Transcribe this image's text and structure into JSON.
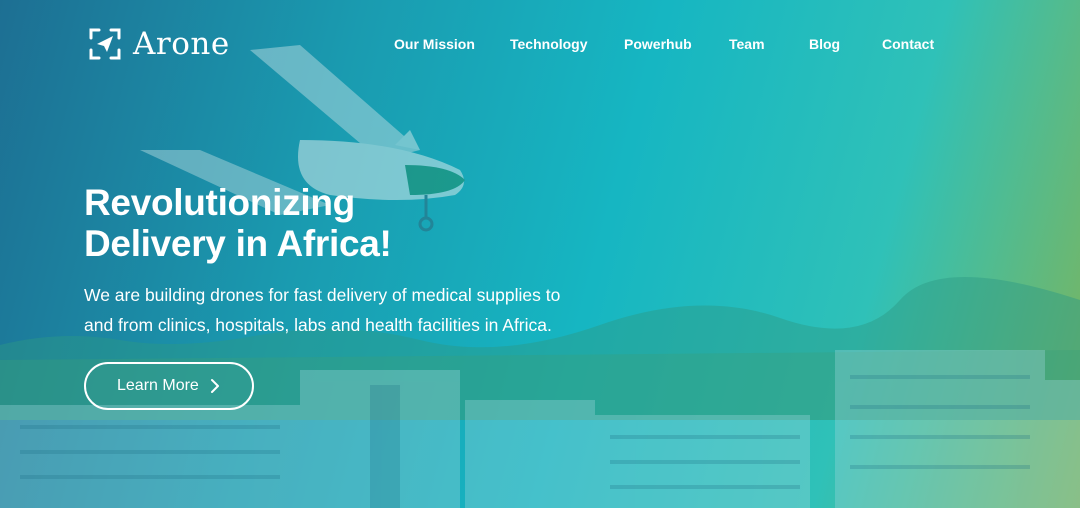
{
  "brand": {
    "name": "Arone",
    "logo_icon": "paper-plane-frame-icon"
  },
  "nav": {
    "items": [
      {
        "label": "Our Mission"
      },
      {
        "label": "Technology"
      },
      {
        "label": "Powerhub"
      },
      {
        "label": "Team"
      },
      {
        "label": "Blog"
      },
      {
        "label": "Contact"
      }
    ]
  },
  "hero": {
    "headline_line1": "Revolutionizing",
    "headline_line2": "Delivery in Africa!",
    "subtitle_line1": "We are building drones for fast delivery of medical supplies to",
    "subtitle_line2": "and from clinics, hospitals, labs and health facilities in Africa.",
    "cta_label": "Learn More",
    "cta_icon": "chevron-right-icon"
  },
  "colors": {
    "gradient_start": "#1d6f93",
    "gradient_mid": "#16b6c2",
    "gradient_end": "#7fb45a",
    "text": "#ffffff"
  }
}
